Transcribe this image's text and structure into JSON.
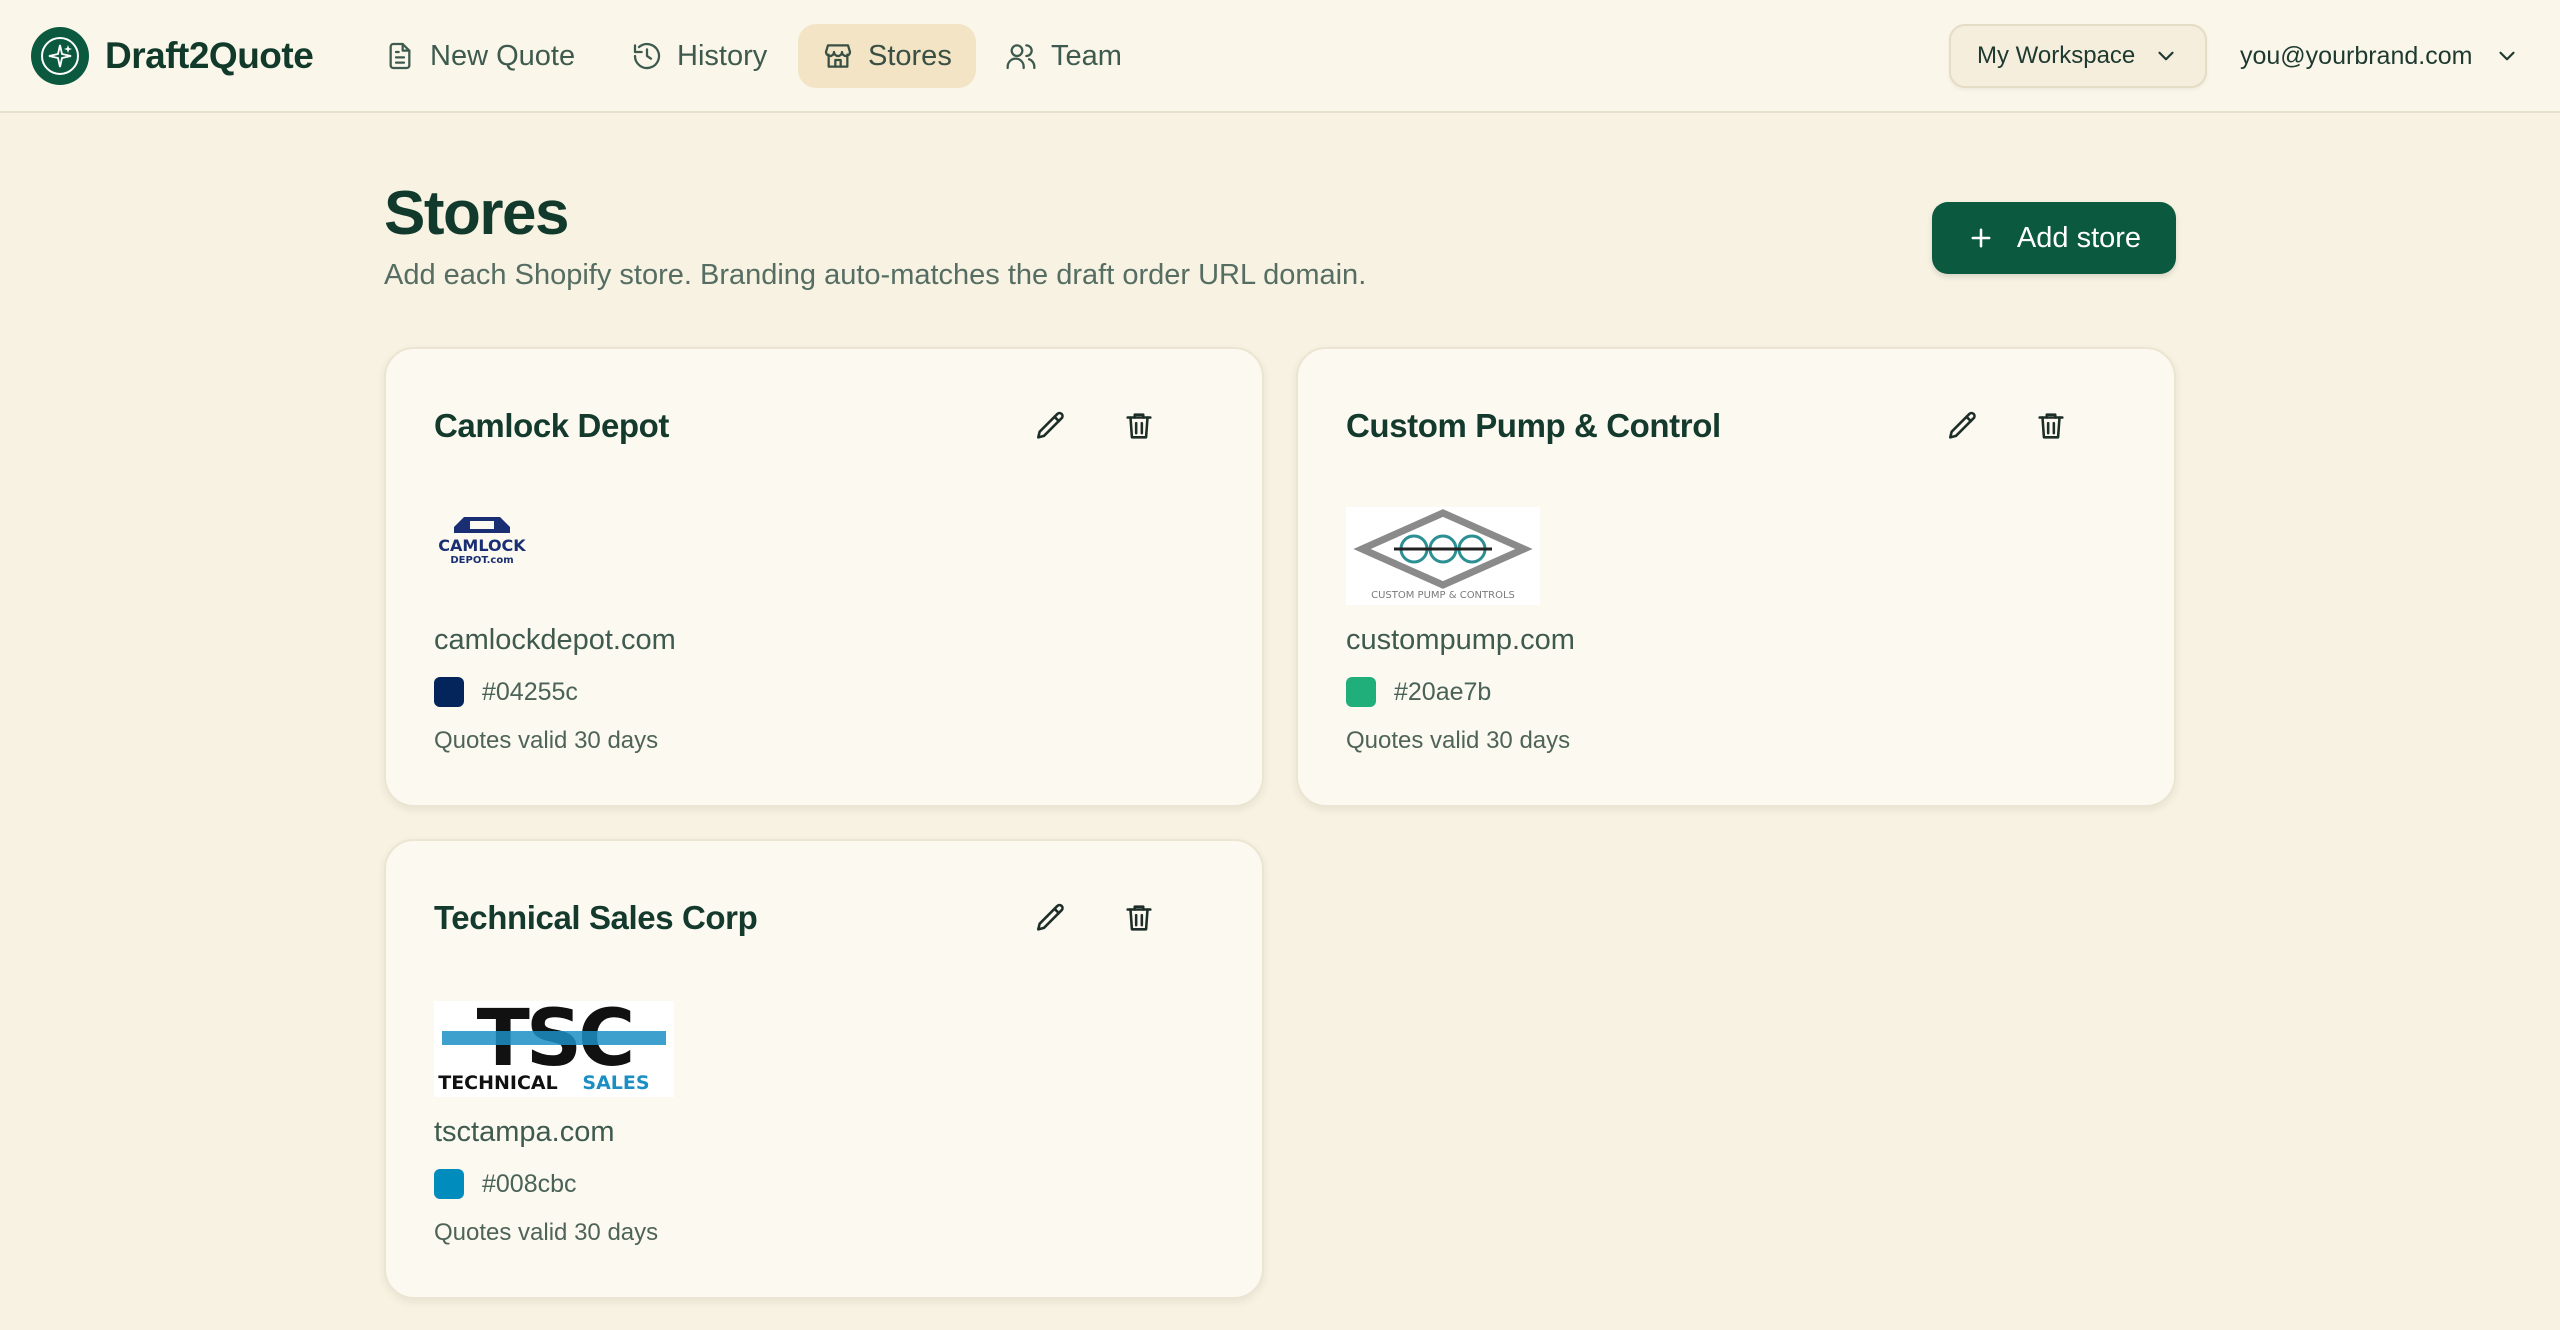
{
  "app": {
    "name": "Draft2Quote"
  },
  "nav": {
    "items": [
      {
        "label": "New Quote",
        "icon": "document-icon"
      },
      {
        "label": "History",
        "icon": "history-icon"
      },
      {
        "label": "Stores",
        "icon": "store-icon",
        "active": true
      },
      {
        "label": "Team",
        "icon": "users-icon"
      }
    ],
    "workspace_label": "My Workspace",
    "account_email": "you@yourbrand.com"
  },
  "page": {
    "title": "Stores",
    "subtitle": "Add each Shopify store. Branding auto-matches the draft order URL domain.",
    "add_button_label": "Add store"
  },
  "colors": {
    "brand": "#0b5a40",
    "background": "#f7f2e2"
  },
  "stores": [
    {
      "name": "Camlock Depot",
      "domain": "camlockdepot.com",
      "color": "#04255c",
      "validity": "Quotes valid 30 days",
      "logo_text": "CAMLOCK DEPOT.com"
    },
    {
      "name": "Custom Pump & Control",
      "domain": "custompump.com",
      "color": "#20ae7b",
      "validity": "Quotes valid 30 days",
      "logo_text": "CUSTOM PUMP & CONTROLS"
    },
    {
      "name": "Technical Sales Corp",
      "domain": "tsctampa.com",
      "color": "#008cbc",
      "validity": "Quotes valid 30 days",
      "logo_text": "TSC TECHNICALSALES"
    }
  ]
}
